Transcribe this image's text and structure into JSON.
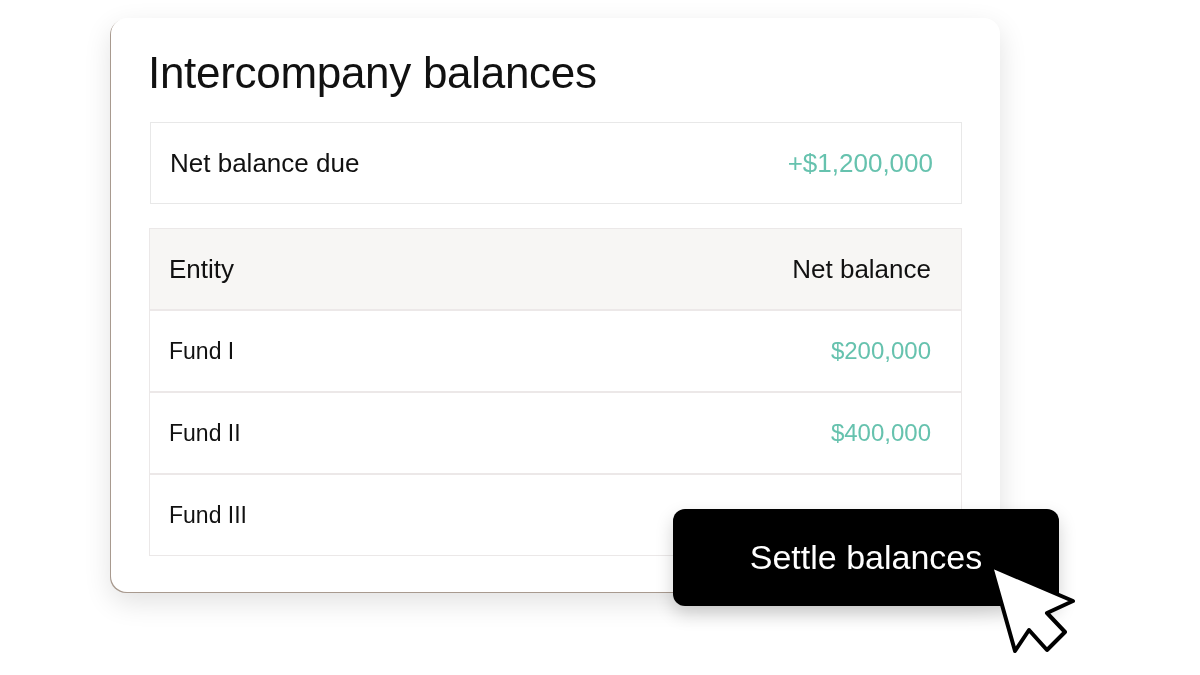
{
  "card": {
    "title": "Intercompany balances",
    "summary": {
      "label": "Net balance due",
      "value": "+$1,200,000"
    },
    "table": {
      "columns": [
        "Entity",
        "Net balance"
      ],
      "rows": [
        {
          "entity": "Fund I",
          "net_balance": "$200,000"
        },
        {
          "entity": "Fund II",
          "net_balance": "$400,000"
        },
        {
          "entity": "Fund III"
        }
      ]
    }
  },
  "button": {
    "label": "Settle balances"
  }
}
